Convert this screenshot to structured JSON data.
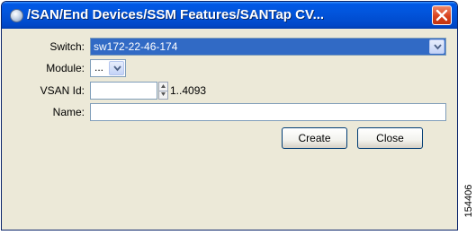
{
  "window": {
    "title": "/SAN/End Devices/SSM Features/SANTap CV...",
    "close_icon": "close-icon",
    "app_icon": "app-icon"
  },
  "form": {
    "switch": {
      "label": "Switch:",
      "value": "sw172-22-46-174"
    },
    "module": {
      "label": "Module:",
      "value": "..."
    },
    "vsan_id": {
      "label": "VSAN Id:",
      "value": "",
      "range": "1..4093"
    },
    "name": {
      "label": "Name:",
      "value": ""
    }
  },
  "buttons": {
    "create": "Create",
    "close": "Close"
  },
  "watermark": "154406",
  "colors": {
    "titlebar": "#0058e6",
    "selection": "#316ac5",
    "dialog_bg": "#ece9d8",
    "close_button": "#d8421e"
  }
}
